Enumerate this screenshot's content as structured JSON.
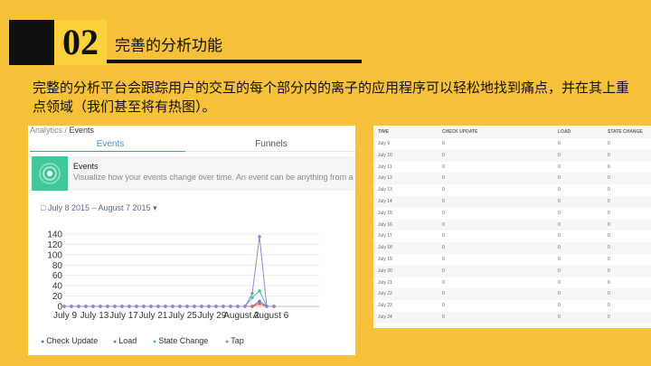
{
  "slide": {
    "number": "02",
    "title": "完善的分析功能",
    "body": "完整的分析平台会跟踪用户的交互的每个部分内的离子的应用程序可以轻松地找到痛点，并在其上重点领域（我们甚至将有热图）。"
  },
  "analytics": {
    "breadcrumb_root": "Analytics",
    "breadcrumb_sep": " / ",
    "breadcrumb_current": "Events",
    "tabs": [
      "Events",
      "Funnels"
    ],
    "events_title": "Events",
    "events_desc": "Visualize how your events change over time. An event can be anything from a",
    "date_range": "July 8 2015 – August 7 2015"
  },
  "chart_data": {
    "type": "line",
    "x": [
      "July 9",
      "July 13",
      "July 17",
      "July 21",
      "July 25",
      "July 29",
      "August 2",
      "August 6"
    ],
    "yticks": [
      0,
      20,
      40,
      60,
      80,
      100,
      120,
      140
    ],
    "ylim": [
      0,
      140
    ],
    "series": [
      {
        "name": "Check Update",
        "color": "#4a7cd9",
        "values": [
          0,
          0,
          0,
          0,
          0,
          0,
          0,
          0,
          0,
          0,
          0,
          0,
          0,
          0,
          0,
          0,
          0,
          0,
          0,
          0,
          0,
          0,
          0,
          0,
          0,
          0,
          0,
          10,
          0,
          0
        ]
      },
      {
        "name": "Load",
        "color": "#e85a5a",
        "values": [
          0,
          0,
          0,
          0,
          0,
          0,
          0,
          0,
          0,
          0,
          0,
          0,
          0,
          0,
          0,
          0,
          0,
          0,
          0,
          0,
          0,
          0,
          0,
          0,
          0,
          0,
          0,
          5,
          0,
          0
        ]
      },
      {
        "name": "State Change",
        "color": "#40c4a0",
        "values": [
          0,
          0,
          0,
          0,
          0,
          0,
          0,
          0,
          0,
          0,
          0,
          0,
          0,
          0,
          0,
          0,
          0,
          0,
          0,
          0,
          0,
          0,
          0,
          0,
          0,
          0,
          17,
          30,
          0,
          0
        ]
      },
      {
        "name": "Tap",
        "color": "#9b7fe0",
        "values": [
          0,
          0,
          0,
          0,
          0,
          0,
          0,
          0,
          0,
          0,
          0,
          0,
          0,
          0,
          0,
          0,
          0,
          0,
          0,
          0,
          0,
          0,
          0,
          0,
          0,
          0,
          25,
          135,
          0,
          0
        ]
      }
    ]
  },
  "table": {
    "headers": [
      "TIME",
      "CHECK UPDATE",
      "LOAD",
      "STATE CHANGE"
    ],
    "rows": [
      [
        "July 9",
        "0",
        "0",
        "0"
      ],
      [
        "July 10",
        "0",
        "0",
        "0"
      ],
      [
        "July 11",
        "0",
        "0",
        "0"
      ],
      [
        "July 12",
        "0",
        "0",
        "0"
      ],
      [
        "July 13",
        "0",
        "0",
        "0"
      ],
      [
        "July 14",
        "0",
        "0",
        "0"
      ],
      [
        "July 15",
        "0",
        "0",
        "0"
      ],
      [
        "July 16",
        "0",
        "0",
        "0"
      ],
      [
        "July 17",
        "0",
        "0",
        "0"
      ],
      [
        "July 18",
        "0",
        "0",
        "0"
      ],
      [
        "July 19",
        "0",
        "0",
        "0"
      ],
      [
        "July 20",
        "0",
        "0",
        "0"
      ],
      [
        "July 21",
        "0",
        "0",
        "0"
      ],
      [
        "July 22",
        "0",
        "0",
        "0"
      ],
      [
        "July 23",
        "0",
        "0",
        "0"
      ],
      [
        "July 24",
        "0",
        "0",
        "0"
      ]
    ]
  }
}
